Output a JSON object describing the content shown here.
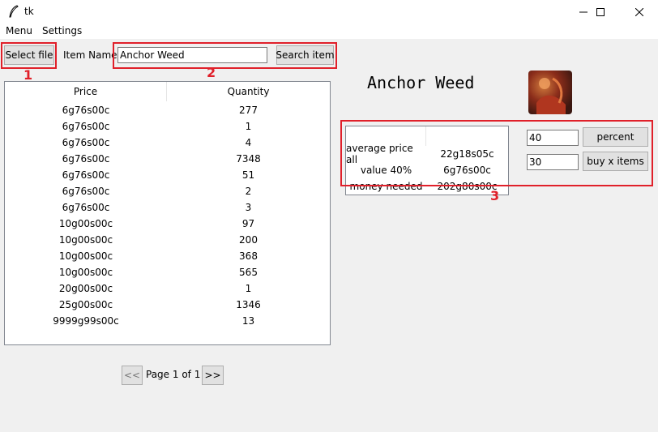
{
  "window": {
    "title": "tk",
    "min_icon": "minimize-icon",
    "max_icon": "maximize-icon",
    "close_icon": "close-icon"
  },
  "menubar": [
    "Menu",
    "Settings"
  ],
  "toolbar": {
    "select_file_label": "Select file",
    "item_name_label": "Item Name",
    "search_value": "Anchor Weed",
    "search_label": "Search item"
  },
  "annotations": {
    "one": "1",
    "two": "2",
    "three": "3",
    "color": "#e0202a"
  },
  "table": {
    "headers": {
      "price": "Price",
      "quantity": "Quantity"
    },
    "rows": [
      {
        "price": "6g76s00c",
        "quantity": "277"
      },
      {
        "price": "6g76s00c",
        "quantity": "1"
      },
      {
        "price": "6g76s00c",
        "quantity": "4"
      },
      {
        "price": "6g76s00c",
        "quantity": "7348"
      },
      {
        "price": "6g76s00c",
        "quantity": "51"
      },
      {
        "price": "6g76s00c",
        "quantity": "2"
      },
      {
        "price": "6g76s00c",
        "quantity": "3"
      },
      {
        "price": "10g00s00c",
        "quantity": "97"
      },
      {
        "price": "10g00s00c",
        "quantity": "200"
      },
      {
        "price": "10g00s00c",
        "quantity": "368"
      },
      {
        "price": "10g00s00c",
        "quantity": "565"
      },
      {
        "price": "20g00s00c",
        "quantity": "1"
      },
      {
        "price": "25g00s00c",
        "quantity": "1346"
      },
      {
        "price": "9999g99s00c",
        "quantity": "13"
      }
    ]
  },
  "pagination": {
    "prev_label": "<<",
    "page_label": "Page 1 of 1",
    "next_label": ">>"
  },
  "item": {
    "title": "Anchor Weed",
    "image_icon": "item-image"
  },
  "stats": {
    "rows": [
      {
        "key": "average price all",
        "value": "22g18s05c"
      },
      {
        "key": "value 40%",
        "value": "6g76s00c"
      },
      {
        "key": "money needed",
        "value": "202g80s00c"
      }
    ]
  },
  "controls": {
    "percent_value": "40",
    "percent_label": "percent",
    "count_value": "30",
    "buy_label": "buy x items"
  }
}
